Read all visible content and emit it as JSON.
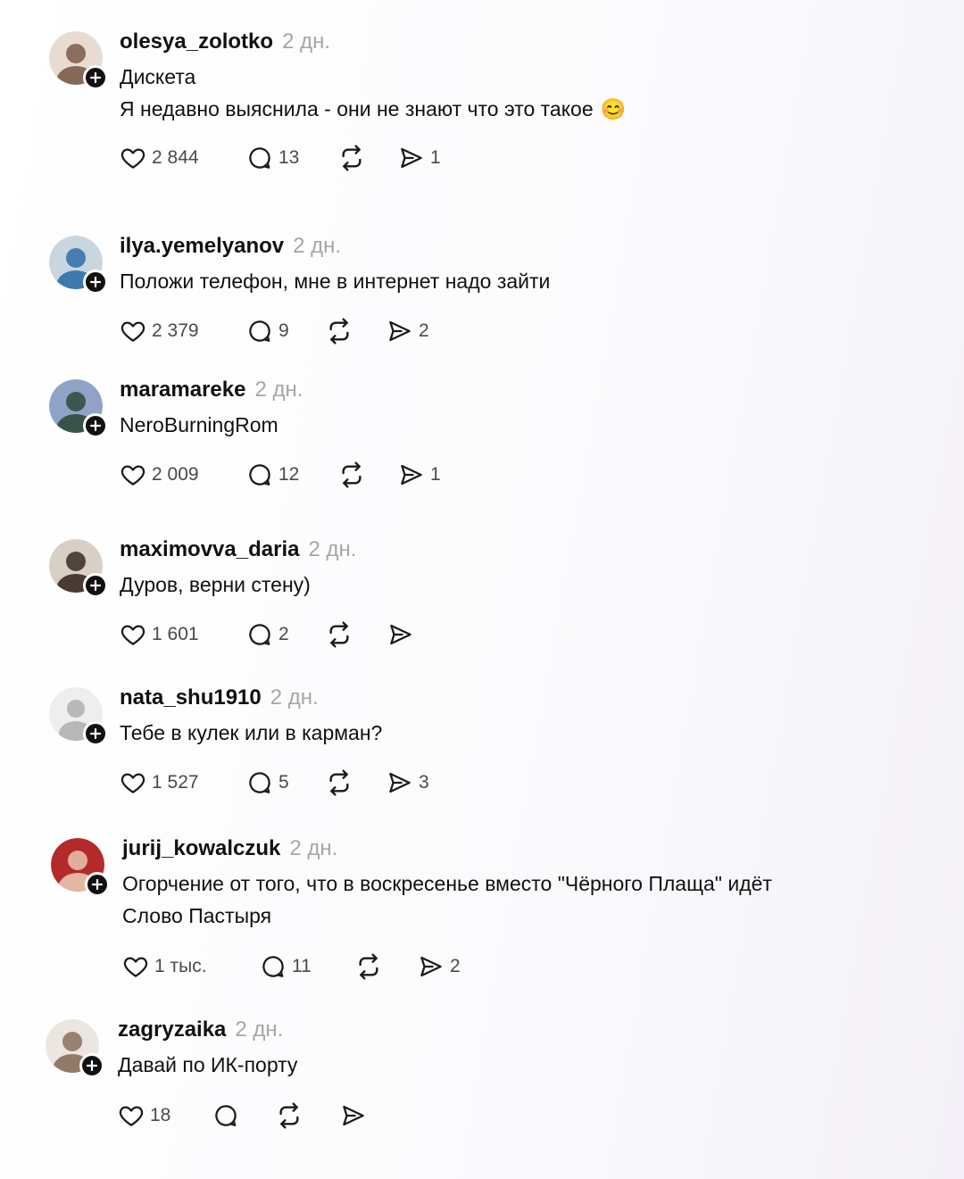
{
  "comments": [
    {
      "username": "olesya_zolotko",
      "time": "2 дн.",
      "lines": [
        "Дискета",
        "Я недавно выяснила - они не знают что это такое"
      ],
      "emoji": "😊",
      "likes": "2 844",
      "replies": "13",
      "shares": "1",
      "avatar_colors": [
        "#e8dcd2",
        "#7b5b48"
      ]
    },
    {
      "username": "ilya.yemelyanov",
      "time": "2 дн.",
      "lines": [
        "Положи телефон, мне в интернет надо зайти"
      ],
      "likes": "2 379",
      "replies": "9",
      "shares": "2",
      "avatar_colors": [
        "#c9d6e0",
        "#2f6fa8"
      ]
    },
    {
      "username": "maramareke",
      "time": "2 дн.",
      "lines": [
        "NeroBurningRom"
      ],
      "likes": "2 009",
      "replies": "12",
      "shares": "1",
      "avatar_colors": [
        "#8ea3c6",
        "#2e4a3a"
      ]
    },
    {
      "username": "maximovva_daria",
      "time": "2 дн.",
      "lines": [
        "Дуров, верни стену)"
      ],
      "likes": "1 601",
      "replies": "2",
      "shares": "",
      "avatar_colors": [
        "#d8cfc7",
        "#3b2a22"
      ]
    },
    {
      "username": "nata_shu1910",
      "time": "2 дн.",
      "lines": [
        "Тебе в кулек или в карман?"
      ],
      "likes": "1 527",
      "replies": "5",
      "shares": "3",
      "avatar_colors": [
        "#eeeeee",
        "#b8b8b8"
      ]
    },
    {
      "username": "jurij_kowalczuk",
      "time": "2 дн.",
      "lines": [
        "Огорчение от того, что в воскресенье вместо \"Чёрного Плаща\" идёт",
        "Слово Пастыря"
      ],
      "likes": "1 тыс.",
      "replies": "11",
      "shares": "2",
      "avatar_colors": [
        "#b42a2a",
        "#e9c6b0"
      ]
    },
    {
      "username": "zagryzaika",
      "time": "2 дн.",
      "lines": [
        "Давай по ИК-порту"
      ],
      "likes": "18",
      "replies": "",
      "shares": "",
      "avatar_colors": [
        "#ece6e0",
        "#8a6e5a"
      ]
    }
  ]
}
